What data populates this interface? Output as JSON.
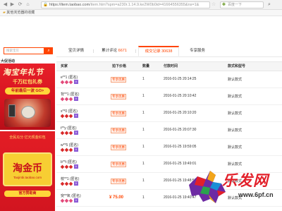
{
  "browser": {
    "url_host": "https://item.taobao.com",
    "url_path": "/item.htm?spm=a230r.1.14.9.ke2W0b0id=41664556355&ns=1&",
    "search_placeholder": "百度一下",
    "favorite_folder": "其他浏览器的收藏",
    "back_icon": "back-arrow-icon",
    "forward_icon": "forward-arrow-icon",
    "refresh_icon": "refresh-icon"
  },
  "shop_search": {
    "placeholder": "搜索宝贝",
    "button_icon": "search-icon"
  },
  "tabs": [
    {
      "label": "宝贝详情",
      "num": ""
    },
    {
      "label": "累计评论",
      "num": "6671"
    },
    {
      "label": "成交记录",
      "num": "30638"
    },
    {
      "label": "专享服务",
      "num": ""
    }
  ],
  "sidebar": {
    "title": "大促活动",
    "ad1": {
      "title": "淘宝年礼节",
      "subtitle": "千万红包礼券",
      "button": "年前最后一波 GO>"
    },
    "ad2": {
      "top": "全民瓜分 亿元现金红包",
      "brand": "淘金币",
      "url": "Taojinbi.taobao.com",
      "bottom": "官方赞助商"
    }
  },
  "table": {
    "headers": [
      "买家",
      "拍下价格",
      "数量",
      "付款时间",
      "款式和型号"
    ],
    "rows": [
      {
        "buyer": "e**1 (匿名)",
        "level": "diamond",
        "vip": "V",
        "price": "专享优惠",
        "qty": "1",
        "time": "2016-01-25 20:14:25",
        "style": "默认款式"
      },
      {
        "buyer": "背**1 (匿名)",
        "level": "diamond",
        "vip": "V",
        "price": "专享优惠",
        "qty": "1",
        "time": "2016-01-25 20:10:42",
        "style": "默认款式"
      },
      {
        "buyer": "s**0 (匿名)",
        "level": "red",
        "vip": "V",
        "price": "专享优惠",
        "qty": "1",
        "time": "2016-01-25 20:10:20",
        "style": "默认款式"
      },
      {
        "buyer": "t**y (匿名)",
        "level": "red",
        "vip": "V",
        "price": "专享优惠",
        "qty": "1",
        "time": "2016-01-25 20:07:30",
        "style": "默认款式"
      },
      {
        "buyer": "w**5 (匿名)",
        "level": "red",
        "vip": "V",
        "price": "专享优惠",
        "qty": "1",
        "time": "2016-01-25 19:59:05",
        "style": "默认款式"
      },
      {
        "buyer": "b**t (匿名)",
        "level": "red",
        "vip": "V",
        "price": "专享优惠",
        "qty": "1",
        "time": "2016-01-25 19:49:01",
        "style": "默认款式"
      },
      {
        "buyer": "枝**1 (匿名)",
        "level": "red",
        "vip": "V",
        "price": "专享优惠",
        "qty": "1",
        "time": "2016-01-25 19:48:56",
        "style": "默认款式"
      },
      {
        "buyer": "突**氧 (匿名)",
        "level": "diamond",
        "vip": "V",
        "price": "¥ 75.00",
        "qty": "1",
        "time": "2016-01-25 19:40:47",
        "style": "默认款式"
      }
    ]
  },
  "watermark": {
    "brand": "乐发网",
    "url": "www.6pf.cn"
  }
}
